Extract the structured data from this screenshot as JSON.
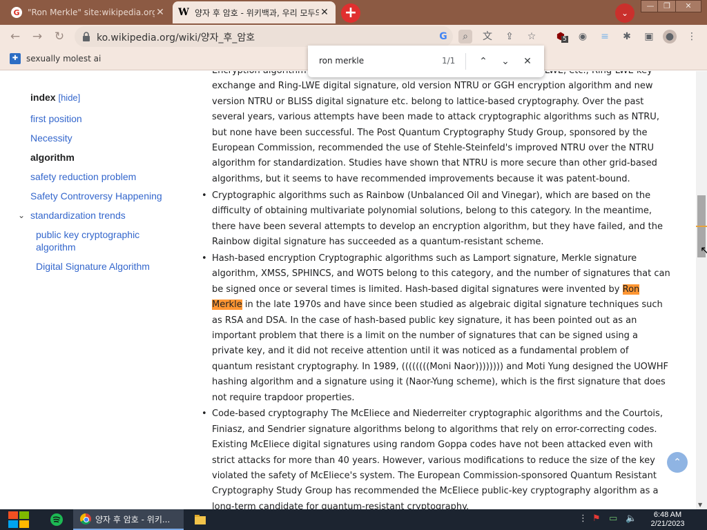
{
  "browser": {
    "tabs": [
      {
        "title": "\"Ron Merkle\" site:wikipedia.org",
        "active": false,
        "favicon": "google-icon"
      },
      {
        "title": "양자 후 암호 - 위키백과, 우리 모두의 백과사전",
        "active": true,
        "favicon": "wikipedia-icon"
      }
    ],
    "new_tab_glyph": "+",
    "url": "ko.wikipedia.org/wiki/양자_후_암호",
    "extension_badge": "5"
  },
  "bookmarks": [
    {
      "label": "sexually molest ai"
    }
  ],
  "find": {
    "query": "ron merkle",
    "count": "1/1"
  },
  "toc": {
    "heading": "index",
    "hide_label": "[hide]",
    "items": [
      {
        "label": "first position"
      },
      {
        "label": "Necessity"
      },
      {
        "label": "algorithm",
        "current": true
      },
      {
        "label": "safety reduction problem"
      },
      {
        "label": "Safety Controversy Happening"
      },
      {
        "label": "standardization trends"
      },
      {
        "label": "public key cryptographic algorithm"
      },
      {
        "label": "Digital Signature Algorithm"
      }
    ]
  },
  "article": {
    "b1": "Encryption algorithm based on lattice (such as learning with errors), Ring-LWE, etc., Ring-LWE key exchange and Ring-LWE digital signature, old version NTRU or GGH encryption algorithm and new version NTRU or BLISS digital signature etc. belong to lattice-based cryptography. Over the past several years, various attempts have been made to attack cryptographic algorithms such as NTRU, but none have been successful. The Post Quantum Cryptography Study Group, sponsored by the European Commission, recommended the use of Stehle-Steinfeld's improved NTRU over the NTRU algorithm for standardization. Studies have shown that NTRU is more secure than other grid-based algorithms, but it seems to have recommended improvements because it was patent-bound.",
    "b2": "Cryptographic algorithms such as Rainbow (Unbalanced Oil and Vinegar), which are based on the difficulty of obtaining multivariate polynomial solutions, belong to this category. In the meantime, there have been several attempts to develop an encryption algorithm, but they have failed, and the Rainbow digital signature has succeeded as a quantum-resistant scheme.",
    "b3_before": "Hash-based encryption Cryptographic algorithms such as Lamport signature, Merkle signature algorithm, XMSS, SPHINCS, and WOTS belong to this category, and the number of signatures that can be signed once or several times is limited. Hash-based digital signatures were invented by ",
    "b3_highlight": "Ron Merkle",
    "b3_after": " in the late 1970s and have since been studied as algebraic digital signature techniques such as RSA and DSA. In the case of hash-based public key signature, it has been pointed out as an important problem that there is a limit on the number of signatures that can be signed using a private key, and it did not receive attention until it was noticed as a fundamental problem of quantum resistant cryptography. In 1989, ((((((((Moni Naor)))))))) and Moti Yung designed the UOWHF hashing algorithm and a signature using it (Naor-Yung scheme), which is the first signature that does not require trapdoor properties.",
    "b4": "Code-based cryptography The McEliece and Niederreiter cryptographic algorithms and the Courtois, Finiasz, and Sendrier signature algorithms belong to algorithms that rely on error-correcting codes. Existing McEliece digital signatures using random Goppa codes have not been attacked even with strict attacks for more than 40 years. However, various modifications to reduce the size of the key violated the safety of McEliece's system. The European Commission-sponsored Quantum Resistant Cryptography Study Group has recommended the McEliece public-key cryptography algorithm as a long-term candidate for quantum-resistant cryptography."
  },
  "taskbar": {
    "chrome_label": "양자 후 암호 - 위키...",
    "time": "6:48 AM",
    "date": "2/21/2023"
  },
  "colors": {
    "tab_strip": "#8c5a43",
    "toolbar": "#f4e7df",
    "link": "#3366cc",
    "find_highlight": "#ff9632"
  }
}
